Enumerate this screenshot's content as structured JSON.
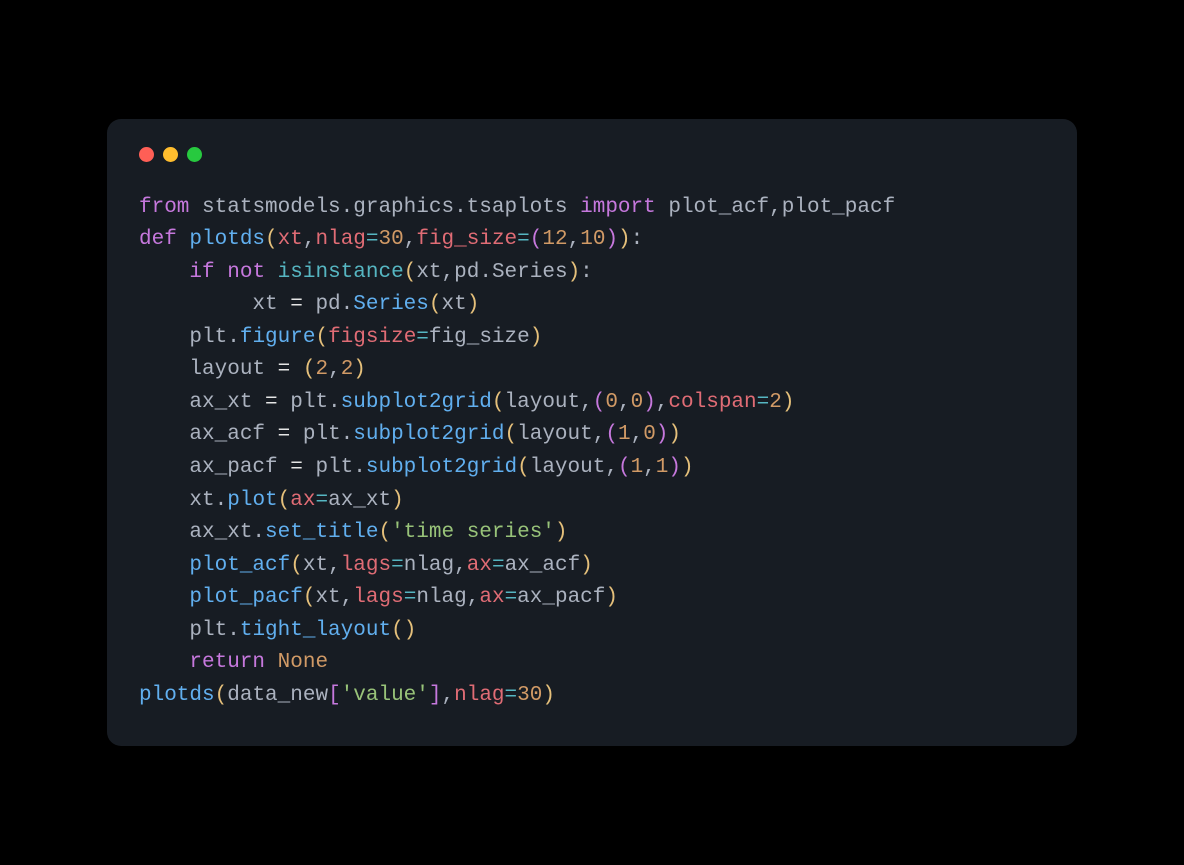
{
  "code": {
    "l1": {
      "kw_from": "from",
      "mod": "statsmodels.graphics.tsaplots",
      "kw_import": "import",
      "names": "plot_acf,plot_pacf"
    },
    "l2": {
      "kw_def": "def",
      "fn": "plotds",
      "p1": "xt",
      "p2": "nlag",
      "eq1": "=",
      "n30": "30",
      "p3": "fig_size",
      "eq2": "=",
      "lp": "(",
      "n12": "12",
      "c": ",",
      "n10": "10",
      "rp": ")",
      "rp2": "):"
    },
    "l3": {
      "pad": "    ",
      "kw_if": "if",
      "kw_not": "not",
      "fn": "isinstance",
      "lp": "(",
      "xt": "xt",
      "c": ",",
      "pd": "pd.Series",
      "rp": "):"
    },
    "l4": {
      "pad": "         ",
      "xt": "xt",
      "eq": " = ",
      "pd": "pd.",
      "series": "Series",
      "lp": "(",
      "arg": "xt",
      "rp": ")"
    },
    "l5": {
      "pad": "    ",
      "plt": "plt.",
      "fig": "figure",
      "lp": "(",
      "k": "figsize",
      "eq": "=",
      "v": "fig_size",
      "rp": ")"
    },
    "l6": {
      "pad": "    ",
      "layout": "layout",
      "eq": " = ",
      "lp": "(",
      "n2a": "2",
      "c": ",",
      "n2b": "2",
      "rp": ")"
    },
    "l7": {
      "pad": "    ",
      "ax": "ax_xt",
      "eq": " = ",
      "plt": "plt.",
      "fn": "subplot2grid",
      "lp": "(",
      "layout": "layout",
      "c": ",",
      "lp2": "(",
      "n0a": "0",
      "c2": ",",
      "n0b": "0",
      "rp2": ")",
      "c3": ",",
      "k": "colspan",
      "eq2": "=",
      "n2": "2",
      "rp": ")"
    },
    "l8": {
      "pad": "    ",
      "ax": "ax_acf",
      "eq": " = ",
      "plt": "plt.",
      "fn": "subplot2grid",
      "lp": "(",
      "layout": "layout",
      "c": ",",
      "lp2": "(",
      "n1": "1",
      "c2": ",",
      "n0": "0",
      "rp2": ")",
      "rp": ")"
    },
    "l9": {
      "pad": "    ",
      "ax": "ax_pacf",
      "eq": " = ",
      "plt": "plt.",
      "fn": "subplot2grid",
      "lp": "(",
      "layout": "layout",
      "c": ",",
      "lp2": "(",
      "n1a": "1",
      "c2": ",",
      "n1b": "1",
      "rp2": ")",
      "rp": ")"
    },
    "l10": {
      "pad": "    ",
      "xt": "xt.",
      "fn": "plot",
      "lp": "(",
      "k": "ax",
      "eq": "=",
      "v": "ax_xt",
      "rp": ")"
    },
    "l11": {
      "pad": "    ",
      "ax": "ax_xt.",
      "fn": "set_title",
      "lp": "(",
      "str": "'time series'",
      "rp": ")"
    },
    "l12": {
      "pad": "    ",
      "fn": "plot_acf",
      "lp": "(",
      "xt": "xt",
      "c": ",",
      "k1": "lags",
      "eq1": "=",
      "v1": "nlag",
      "c2": ",",
      "k2": "ax",
      "eq2": "=",
      "v2": "ax_acf",
      "rp": ")"
    },
    "l13": {
      "pad": "    ",
      "fn": "plot_pacf",
      "lp": "(",
      "xt": "xt",
      "c": ",",
      "k1": "lags",
      "eq1": "=",
      "v1": "nlag",
      "c2": ",",
      "k2": "ax",
      "eq2": "=",
      "v2": "ax_pacf",
      "rp": ")"
    },
    "l14": {
      "pad": "    ",
      "plt": "plt.",
      "fn": "tight_layout",
      "lp": "(",
      "rp": ")"
    },
    "l15": {
      "pad": "    ",
      "kw": "return",
      "none": "None"
    },
    "l16": {
      "fn": "plotds",
      "lp": "(",
      "dn": "data_new",
      "lb": "[",
      "str": "'value'",
      "rb": "]",
      "c": ",",
      "k": "nlag",
      "eq": "=",
      "n": "30",
      "rp": ")"
    }
  }
}
